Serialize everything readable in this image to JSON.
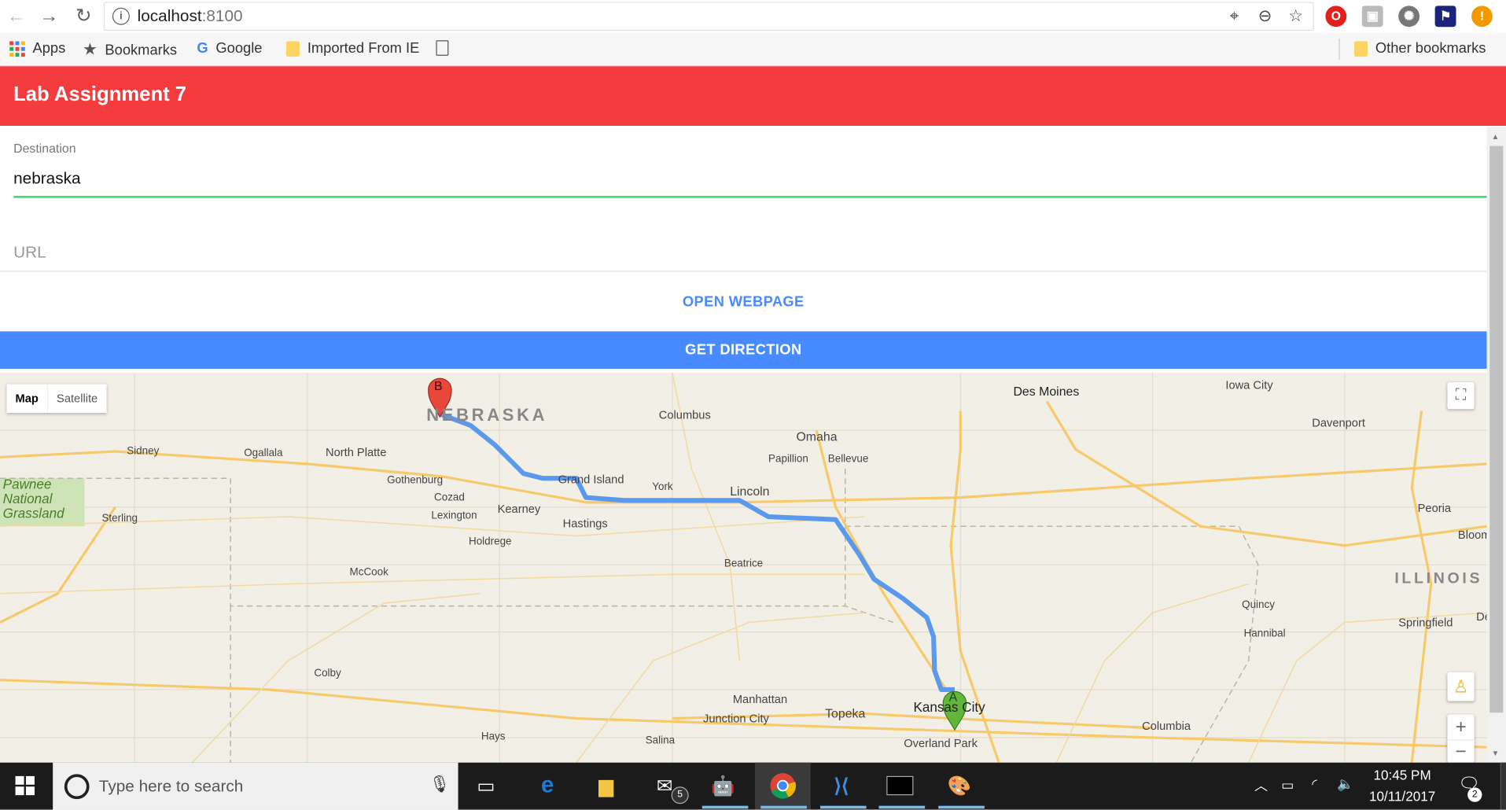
{
  "browser": {
    "url_host": "localhost",
    "url_port": ":8100",
    "bookmarks": [
      {
        "label": "Apps",
        "icon": "apps-grid-icon"
      },
      {
        "label": "Bookmarks",
        "icon": "star-icon"
      },
      {
        "label": "Google",
        "icon": "google-icon"
      },
      {
        "label": "Imported From IE",
        "icon": "folder-icon"
      }
    ],
    "other_bookmarks": "Other bookmarks"
  },
  "app": {
    "title": "Lab Assignment 7",
    "header_color": "#f43c3f",
    "destination_label": "Destination",
    "destination_value": "nebraska",
    "url_placeholder": "URL",
    "open_webpage_label": "OPEN WEBPAGE",
    "get_direction_label": "GET DIRECTION",
    "accent": "#488aff"
  },
  "map": {
    "type_map": "Map",
    "type_satellite": "Satellite",
    "marker_a": "A",
    "marker_b": "B",
    "state_labels": [
      "NEBRASKA",
      "ILLINOIS"
    ],
    "places": [
      "Des Moines",
      "Iowa City",
      "Davenport",
      "Columbus",
      "Omaha",
      "Papillion",
      "Bellevue",
      "Sidney",
      "Ogallala",
      "North Platte",
      "Gothenburg",
      "Cozad",
      "Lexington",
      "Kearney",
      "Grand Island",
      "York",
      "Lincoln",
      "Hastings",
      "Holdrege",
      "Sterling",
      "McCook",
      "Beatrice",
      "Peoria",
      "Bloom",
      "Quincy",
      "Hannibal",
      "Springfield",
      "Colby",
      "Manhattan",
      "Junction City",
      "Topeka",
      "Kansas City",
      "Overland Park",
      "Columbia",
      "Hays",
      "Salina",
      "De"
    ],
    "park_label": "Pawnee\nNational\nGrassland",
    "zoom_in": "+",
    "zoom_out": "−"
  },
  "taskbar": {
    "search_placeholder": "Type here to search",
    "time": "10:45 PM",
    "date": "10/11/2017",
    "mail_badge": "5",
    "notif_badge": "2"
  }
}
